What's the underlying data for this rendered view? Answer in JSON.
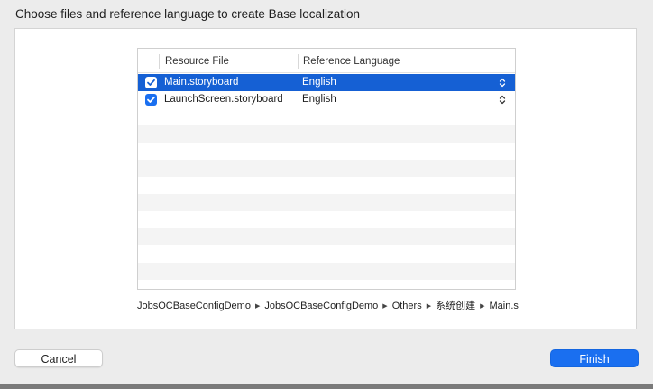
{
  "dialog": {
    "prompt": "Choose files and reference language to create Base localization",
    "table": {
      "columns": [
        "Resource File",
        "Reference Language"
      ],
      "rows": [
        {
          "checked": true,
          "file": "Main.storyboard",
          "language": "English",
          "selected": true
        },
        {
          "checked": true,
          "file": "LaunchScreen.storyboard",
          "language": "English",
          "selected": false
        }
      ]
    },
    "path": [
      "JobsOCBaseConfigDemo",
      "JobsOCBaseConfigDemo",
      "Others",
      "系统创建",
      "Main.s"
    ],
    "buttons": {
      "cancel": "Cancel",
      "finish": "Finish"
    }
  },
  "icons": {
    "checkbox": "checkmark-icon",
    "stepper": "up-down-chevron-icon",
    "path_separator": "triangle-right-icon"
  },
  "colors": {
    "accent": "#1a6ff0",
    "selection": "#1560d4"
  }
}
